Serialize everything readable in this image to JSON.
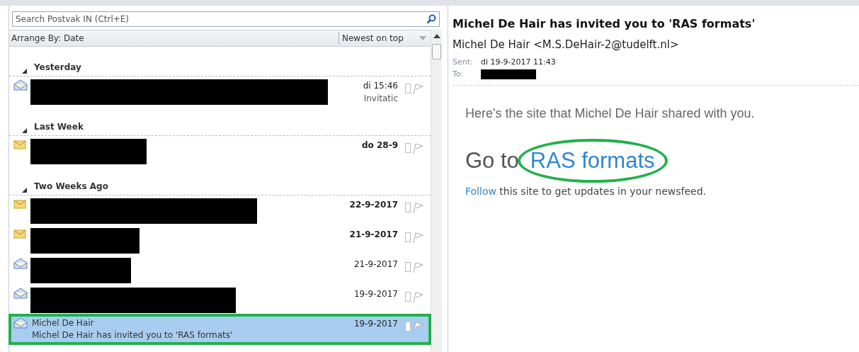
{
  "search": {
    "placeholder": "Search Postvak IN (Ctrl+E)"
  },
  "arrange": {
    "label": "Arrange By: Date",
    "order": "Newest on top"
  },
  "groups": [
    {
      "label": "Yesterday",
      "expanded": true,
      "messages": [
        {
          "kind": "redacted",
          "unread": false,
          "selected": false,
          "highlighted": false,
          "date": "di 15:46",
          "preview": "Invitatic"
        }
      ]
    },
    {
      "label": "Last Week",
      "expanded": true,
      "messages": [
        {
          "kind": "redacted",
          "unread": true,
          "selected": false,
          "highlighted": false,
          "date": "do 28-9"
        }
      ]
    },
    {
      "label": "Two Weeks Ago",
      "expanded": true,
      "messages": [
        {
          "kind": "redacted",
          "unread": true,
          "selected": false,
          "highlighted": false,
          "date": "22-9-2017"
        },
        {
          "kind": "redacted",
          "unread": true,
          "selected": false,
          "highlighted": false,
          "date": "21-9-2017"
        },
        {
          "kind": "redacted",
          "unread": false,
          "selected": false,
          "highlighted": false,
          "date": "21-9-2017"
        },
        {
          "kind": "redacted",
          "unread": false,
          "selected": false,
          "highlighted": false,
          "date": "19-9-2017"
        },
        {
          "kind": "shown",
          "unread": false,
          "selected": true,
          "highlighted": true,
          "sender": "Michel De Hair",
          "subject": "Michel De Hair has invited you to 'RAS formats'",
          "date": "19-9-2017"
        }
      ]
    }
  ],
  "reading": {
    "subject": "Michel De Hair has invited you to 'RAS formats'",
    "from": "Michel De Hair <M.S.DeHair-2@tudelft.nl>",
    "sent_label": "Sent:",
    "sent": "di 19-9-2017 11:43",
    "to_label": "To:",
    "to_redacted": true,
    "intro": "Here's the site that Michel De Hair shared with you.",
    "go_to": "Go to",
    "site_link": "RAS formats",
    "site_link_circled": true,
    "follow_link": "Follow",
    "follow_text": "this site to get updates in your newsfeed."
  }
}
